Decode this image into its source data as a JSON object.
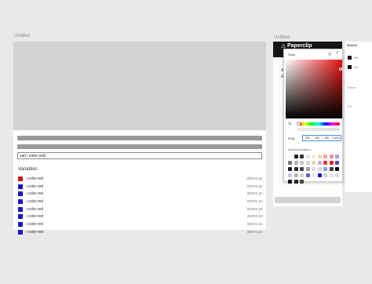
{
  "main_frame": {
    "title": "Untitled",
    "value_input": "var(--color-red)",
    "variables_heading": "Variables",
    "variables": [
      {
        "name": "--color-red",
        "source": "atoms.pc",
        "color": "#d21414"
      },
      {
        "name": "--color-red",
        "source": "atoms.pc",
        "color": "#1a14c8"
      },
      {
        "name": "--color-red",
        "source": "atoms.pc",
        "color": "#1a14c8"
      },
      {
        "name": "--color-red",
        "source": "atoms.pc",
        "color": "#1a14c8"
      },
      {
        "name": "--color-red",
        "source": "atoms.pc",
        "color": "#1a14c8"
      },
      {
        "name": "--color-red",
        "source": "atoms.pc",
        "color": "#1a14c8"
      },
      {
        "name": "--color-red",
        "source": "atoms.pc",
        "color": "#1a14c8"
      },
      {
        "name": "--color-red",
        "source": "atoms.pc",
        "color": "#1a14c8"
      }
    ]
  },
  "side_frame": {
    "title": "Untitled",
    "logo_text": "Paperclip",
    "muted_1": "A",
    "muted_2": "A"
  },
  "right_panel": {
    "header": "Selecti",
    "text_1": "CS",
    "text_2": "Fo",
    "effects_label": "Effects",
    "other_label": "Oth"
  },
  "color_picker": {
    "fill_type": "Solid",
    "target_icon": "target-icon",
    "close_label": "×",
    "mode": "RGB",
    "rgb_values": [
      "255",
      "255",
      "255",
      "100%"
    ],
    "document_colors_label": "Document colors ▾",
    "palette": [
      "#fafafa",
      "#1a1a1a",
      "#333333",
      "#e6e6e6",
      "#f0f0c8",
      "#f0d2b4",
      "#e6aa8c",
      "#f08caa",
      "#a0a0f0",
      "#787878",
      "#b4b4b4",
      "#c8c8c8",
      "#d2d2d2",
      "#dcdcbe",
      "#c8b4d2",
      "#dc3c3c",
      "#e61e1e",
      "#5050b4",
      "#141414",
      "#282828",
      "#464646",
      "#a0a0a0",
      "#dcdcdc",
      "#e6c8e6",
      "#78aadc",
      "#3c3c3c",
      "#0a0a0a",
      "#c8c8f0",
      "#b4b4b4",
      "#d2d2d2",
      "#6464c8",
      "#e6e6e6",
      "#1414dc",
      "#d2d2d2",
      "#e6e6e6",
      "#dcdcdc",
      "#111111",
      "#222222",
      "#444444"
    ]
  }
}
